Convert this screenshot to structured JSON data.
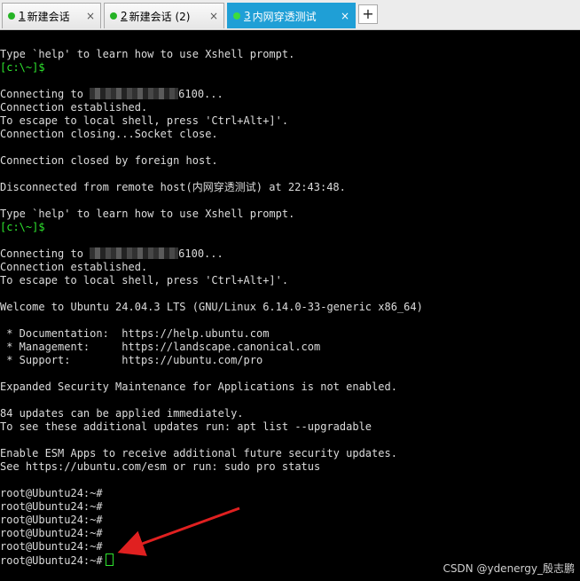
{
  "tabs": [
    {
      "number": "1",
      "label": "新建会话",
      "status_color": "#25b325"
    },
    {
      "number": "2",
      "label": "新建会话 (2)",
      "status_color": "#25b325"
    },
    {
      "number": "3",
      "label": "内网穿透测试",
      "status_color": "#3ddc3d"
    }
  ],
  "add_tab_label": "+",
  "close_glyph": "×",
  "terminal": {
    "lines": [
      "Type `help' to learn how to use Xshell prompt.",
      "[c:\\~]$",
      "",
      "Connecting to ██████████6100...",
      "Connection established.",
      "To escape to local shell, press 'Ctrl+Alt+]'.",
      "Connection closing...Socket close.",
      "",
      "Connection closed by foreign host.",
      "",
      "Disconnected from remote host(内网穿透测试) at 22:43:48.",
      "",
      "Type `help' to learn how to use Xshell prompt.",
      "[c:\\~]$",
      "",
      "Connecting to ██████████6100...",
      "Connection established.",
      "To escape to local shell, press 'Ctrl+Alt+]'.",
      "",
      "Welcome to Ubuntu 24.04.3 LTS (GNU/Linux 6.14.0-33-generic x86_64)",
      "",
      " * Documentation:  https://help.ubuntu.com",
      " * Management:     https://landscape.canonical.com",
      " * Support:        https://ubuntu.com/pro",
      "",
      "Expanded Security Maintenance for Applications is not enabled.",
      "",
      "84 updates can be applied immediately.",
      "To see these additional updates run: apt list --upgradable",
      "",
      "Enable ESM Apps to receive additional future security updates.",
      "See https://ubuntu.com/esm or run: sudo pro status",
      "",
      "root@Ubuntu24:~#",
      "root@Ubuntu24:~#",
      "root@Ubuntu24:~#",
      "root@Ubuntu24:~#",
      "root@Ubuntu24:~#",
      "root@Ubuntu24:~#"
    ],
    "green_prompt": "[c:\\~]$",
    "connecting_prefix": "Connecting to ",
    "connecting_suffix": "6100...",
    "foreground_color": "#dcdcdc",
    "prompt_color": "#2ee42e"
  },
  "annotation": {
    "arrow_color": "#e02020"
  },
  "watermark": "CSDN @ydenergy_殷志鹏"
}
